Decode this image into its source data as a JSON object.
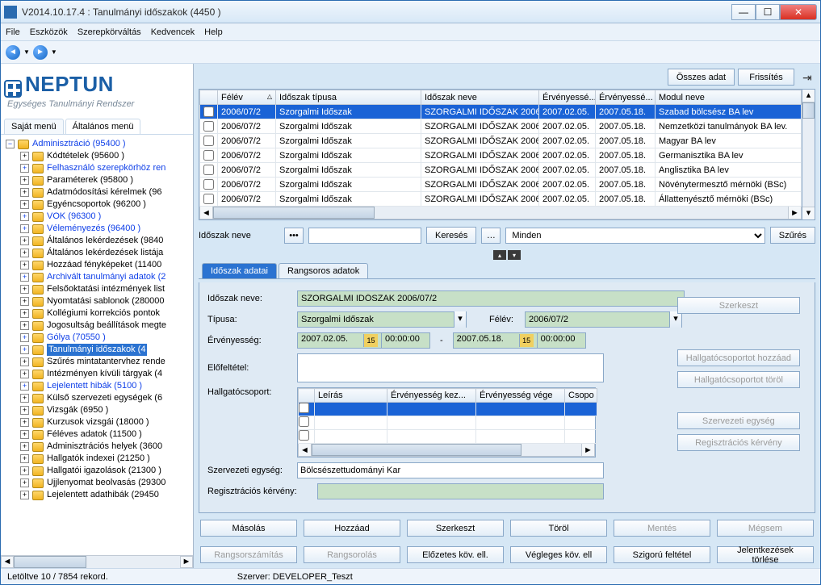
{
  "window": {
    "title": "V2014.10.17.4 : Tanulmányi időszakok (4450  )"
  },
  "menu": [
    "File",
    "Eszközök",
    "Szerepkörváltás",
    "Kedvencek",
    "Help"
  ],
  "logo": {
    "main": "NEPTUN",
    "sub": "Egységes Tanulmányi Rendszer"
  },
  "left_tabs": {
    "own": "Saját menü",
    "general": "Általános menü"
  },
  "tree": {
    "root": "Adminisztráció (95400  )",
    "items": [
      {
        "l": "Kódtételek (95600  )",
        "blue": false
      },
      {
        "l": "Felhasználó szerepkörhöz ren",
        "blue": true
      },
      {
        "l": "Paraméterek (95800  )",
        "blue": false
      },
      {
        "l": "Adatmódosítási kérelmek (96",
        "blue": false
      },
      {
        "l": "Egyéncsoportok (96200  )",
        "blue": false
      },
      {
        "l": "VOK (96300  )",
        "blue": true
      },
      {
        "l": "Véleményezés (96400  )",
        "blue": true
      },
      {
        "l": "Általános lekérdezések (9840",
        "blue": false
      },
      {
        "l": "Általános lekérdezések listája",
        "blue": false
      },
      {
        "l": "Hozzáad fényképeket (11400",
        "blue": false
      },
      {
        "l": "Archivált tanulmányi adatok (2",
        "blue": true
      },
      {
        "l": "Felsőoktatási intézmények list",
        "blue": false
      },
      {
        "l": "Nyomtatási sablonok (280000",
        "blue": false
      },
      {
        "l": "Kollégiumi korrekciós pontok",
        "blue": false
      },
      {
        "l": "Jogosultság beállítások megte",
        "blue": false
      },
      {
        "l": "Gólya (70550  )",
        "blue": true
      },
      {
        "l": "Tanulmányi időszakok (4",
        "blue": true,
        "sel": true
      },
      {
        "l": "Szűrés mintatantervhez rende",
        "blue": false
      },
      {
        "l": "Intézményen kívüli tárgyak (4",
        "blue": false
      },
      {
        "l": "Lejelentett hibák (5100  )",
        "blue": true
      },
      {
        "l": "Külső szervezeti egységek (6",
        "blue": false
      },
      {
        "l": "Vizsgák (6950  )",
        "blue": false
      },
      {
        "l": "Kurzusok vizsgái (18000  )",
        "blue": false
      },
      {
        "l": "Féléves adatok (11500  )",
        "blue": false
      },
      {
        "l": "Adminisztrációs helyek (3600",
        "blue": false
      },
      {
        "l": "Hallgatók indexei (21250  )",
        "blue": false
      },
      {
        "l": "Hallgatói igazolások (21300  )",
        "blue": false
      },
      {
        "l": "Ujjlenyomat beolvasás (29300",
        "blue": false
      },
      {
        "l": "Lejelentett adathibák (29450",
        "blue": false
      }
    ]
  },
  "toolbar": {
    "all_data": "Összes adat",
    "refresh": "Frissítés"
  },
  "grid": {
    "cols": [
      "",
      "Félév",
      "Időszak típusa",
      "Időszak neve",
      "Érvényessé...",
      "Érvényessé...",
      "Modul neve"
    ],
    "rows": [
      {
        "felev": "2006/07/2",
        "tipus": "Szorgalmi Időszak",
        "nev": "SZORGALMI IDŐSZAK 2006",
        "e1": "2007.02.05.",
        "e2": "2007.05.18.",
        "modul": "Szabad bölcsész BA lev",
        "sel": true
      },
      {
        "felev": "2006/07/2",
        "tipus": "Szorgalmi Időszak",
        "nev": "SZORGALMI IDŐSZAK 2006",
        "e1": "2007.02.05.",
        "e2": "2007.05.18.",
        "modul": "Nemzetközi tanulmányok BA lev."
      },
      {
        "felev": "2006/07/2",
        "tipus": "Szorgalmi Időszak",
        "nev": "SZORGALMI IDŐSZAK 2006",
        "e1": "2007.02.05.",
        "e2": "2007.05.18.",
        "modul": "Magyar BA lev"
      },
      {
        "felev": "2006/07/2",
        "tipus": "Szorgalmi Időszak",
        "nev": "SZORGALMI IDŐSZAK 2006",
        "e1": "2007.02.05.",
        "e2": "2007.05.18.",
        "modul": "Germanisztika BA lev"
      },
      {
        "felev": "2006/07/2",
        "tipus": "Szorgalmi Időszak",
        "nev": "SZORGALMI IDŐSZAK 2006",
        "e1": "2007.02.05.",
        "e2": "2007.05.18.",
        "modul": "Anglisztika BA lev"
      },
      {
        "felev": "2006/07/2",
        "tipus": "Szorgalmi Időszak",
        "nev": "SZORGALMI IDŐSZAK 2006",
        "e1": "2007.02.05.",
        "e2": "2007.05.18.",
        "modul": "Növénytermesztő mérnöki (BSc)"
      },
      {
        "felev": "2006/07/2",
        "tipus": "Szorgalmi Időszak",
        "nev": "SZORGALMI IDŐSZAK 2006",
        "e1": "2007.02.05.",
        "e2": "2007.05.18.",
        "modul": "Állattenyésztő mérnöki (BSc)"
      }
    ]
  },
  "filter": {
    "label": "Időszak neve",
    "search": "Keresés",
    "scope": "Minden",
    "filter_btn": "Szűrés"
  },
  "detail_tabs": {
    "t1": "Időszak adatai",
    "t2": "Rangsoros adatok"
  },
  "form": {
    "name_label": "Időszak neve:",
    "name_value": "SZORGALMI IDŐSZAK 2006/07/2",
    "type_label": "Típusa:",
    "type_value": "Szorgalmi Időszak",
    "semester_label": "Félév:",
    "semester_value": "2006/07/2",
    "validity_label": "Érvényesség:",
    "date_from": "2007.02.05.",
    "time_from": "00:00:00",
    "dash": "-",
    "date_to": "2007.05.18.",
    "time_to": "00:00:00",
    "precond_label": "Előfeltétel:",
    "group_label": "Hallgatócsoport:",
    "subgrid_cols": [
      "",
      "Leírás",
      "Érvényesség kez...",
      "Érvényesség vége",
      "Csopo"
    ],
    "org_label": "Szervezeti egység:",
    "org_value": "Bölcsészettudományi Kar",
    "reg_label": "Regisztrációs kérvény:"
  },
  "side_buttons": {
    "edit": "Szerkeszt",
    "add_group": "Hallgatócsoportot hozzáad",
    "del_group": "Hallgatócsoportot töröl",
    "org": "Szervezeti egység",
    "reg": "Regisztrációs kérvény"
  },
  "bottom_buttons": {
    "row1": [
      "Másolás",
      "Hozzáad",
      "Szerkeszt",
      "Töröl",
      "Mentés",
      "Mégsem"
    ],
    "row2": [
      "Rangsorszámítás",
      "Rangsorolás",
      "Előzetes köv. ell.",
      "Végleges köv. ell",
      "Szigorú feltétel",
      "Jelentkezések törlése"
    ],
    "disabled1": [
      false,
      false,
      false,
      false,
      true,
      true
    ],
    "disabled2": [
      true,
      true,
      false,
      false,
      false,
      false
    ]
  },
  "status": {
    "left": "Letöltve 10 / 7854 rekord.",
    "server": "Szerver: DEVELOPER_Teszt"
  }
}
